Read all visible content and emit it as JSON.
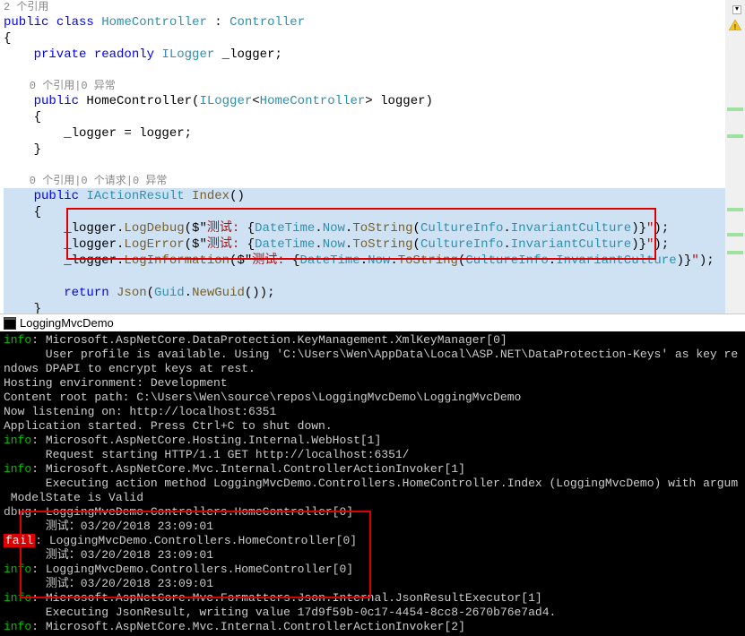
{
  "editor": {
    "ref1": "2 个引用",
    "l1": {
      "t1": "public",
      "t2": "class",
      "t3": "HomeController",
      "t4": " : ",
      "t5": "Controller"
    },
    "l2": "{",
    "l3": {
      "t1": "    private",
      "t2": "readonly",
      "t3": "ILogger",
      "t4": " _logger;"
    },
    "ref2": "    0 个引用|0 异常",
    "l4": {
      "t1": "    public",
      "t2": "HomeController",
      "t3": "(",
      "t4": "ILogger",
      "t5": "<",
      "t6": "HomeController",
      "t7": "> logger)"
    },
    "l5": "    {",
    "l6": {
      "t1": "        _logger = logger;"
    },
    "l7": "    }",
    "ref3": "    0 个引用|0 个请求|0 异常",
    "l8": {
      "t1": "    public",
      "t2": "IActionResult",
      "t3": "Index",
      "t4": "()"
    },
    "l9": "    {",
    "l10": {
      "pre": "        _logger.",
      "m": "LogDebug",
      "a": "($\"",
      "s1": "测试: ",
      "b": "{",
      "d": "DateTime",
      "dot1": ".",
      "p1": "Now",
      "dot2": ".",
      "m2": "ToString",
      "c": "(",
      "ci": "CultureInfo",
      "dot3": ".",
      "p2": "InvariantCulture",
      "e": ")}",
      "s2": "\"",
      "f": ");"
    },
    "l11": {
      "pre": "        _logger.",
      "m": "LogError",
      "a": "($\"",
      "s1": "测试: ",
      "b": "{",
      "d": "DateTime",
      "dot1": ".",
      "p1": "Now",
      "dot2": ".",
      "m2": "ToString",
      "c": "(",
      "ci": "CultureInfo",
      "dot3": ".",
      "p2": "InvariantCulture",
      "e": ")}",
      "s2": "\"",
      "f": ");"
    },
    "l12": {
      "pre": "        _logger.",
      "m": "LogInformation",
      "a": "($\"",
      "s1": "测试: ",
      "b": "{",
      "d": "DateTime",
      "dot1": ".",
      "p1": "Now",
      "dot2": ".",
      "m2": "ToString",
      "c": "(",
      "ci": "CultureInfo",
      "dot3": ".",
      "p2": "InvariantCulture",
      "e": ")}",
      "s2": "\"",
      "f": ");"
    },
    "l13": "",
    "l14": {
      "t1": "        return",
      "t2": "Json",
      "t3": "(",
      "t4": "Guid",
      "t5": ".",
      "t6": "NewGuid",
      "t7": "());"
    },
    "l15": "    }"
  },
  "termTitle": "LoggingMvcDemo",
  "terminal": [
    {
      "lvl": "info",
      "rest": ": Microsoft.AspNetCore.DataProtection.KeyManagement.XmlKeyManager[0]"
    },
    {
      "lvl": "",
      "rest": "      User profile is available. Using 'C:\\Users\\Wen\\AppData\\Local\\ASP.NET\\DataProtection-Keys' as key re"
    },
    {
      "lvl": "",
      "rest": "ndows DPAPI to encrypt keys at rest."
    },
    {
      "lvl": "",
      "rest": "Hosting environment: Development"
    },
    {
      "lvl": "",
      "rest": "Content root path: C:\\Users\\Wen\\source\\repos\\LoggingMvcDemo\\LoggingMvcDemo"
    },
    {
      "lvl": "",
      "rest": "Now listening on: http://localhost:6351"
    },
    {
      "lvl": "",
      "rest": "Application started. Press Ctrl+C to shut down."
    },
    {
      "lvl": "info",
      "rest": ": Microsoft.AspNetCore.Hosting.Internal.WebHost[1]"
    },
    {
      "lvl": "",
      "rest": "      Request starting HTTP/1.1 GET http://localhost:6351/"
    },
    {
      "lvl": "info",
      "rest": ": Microsoft.AspNetCore.Mvc.Internal.ControllerActionInvoker[1]"
    },
    {
      "lvl": "",
      "rest": "      Executing action method LoggingMvcDemo.Controllers.HomeController.Index (LoggingMvcDemo) with argum"
    },
    {
      "lvl": "",
      "rest": " ModelState is Valid"
    },
    {
      "lvl": "dbug",
      "rest": ": LoggingMvcDemo.Controllers.HomeController[0]"
    },
    {
      "lvl": "",
      "rest": "      测试：03/20/2018 23:09:01"
    },
    {
      "lvl": "fail",
      "rest": ": LoggingMvcDemo.Controllers.HomeController[0]"
    },
    {
      "lvl": "",
      "rest": "      测试：03/20/2018 23:09:01"
    },
    {
      "lvl": "info",
      "rest": ": LoggingMvcDemo.Controllers.HomeController[0]"
    },
    {
      "lvl": "",
      "rest": "      测试：03/20/2018 23:09:01"
    },
    {
      "lvl": "info",
      "rest": ": Microsoft.AspNetCore.Mvc.Formatters.Json.Internal.JsonResultExecutor[1]"
    },
    {
      "lvl": "",
      "rest": "      Executing JsonResult, writing value 17d9f59b-0c17-4454-8cc8-2670b76e7ad4."
    },
    {
      "lvl": "info",
      "rest": ": Microsoft.AspNetCore.Mvc.Internal.ControllerActionInvoker[2]"
    }
  ]
}
